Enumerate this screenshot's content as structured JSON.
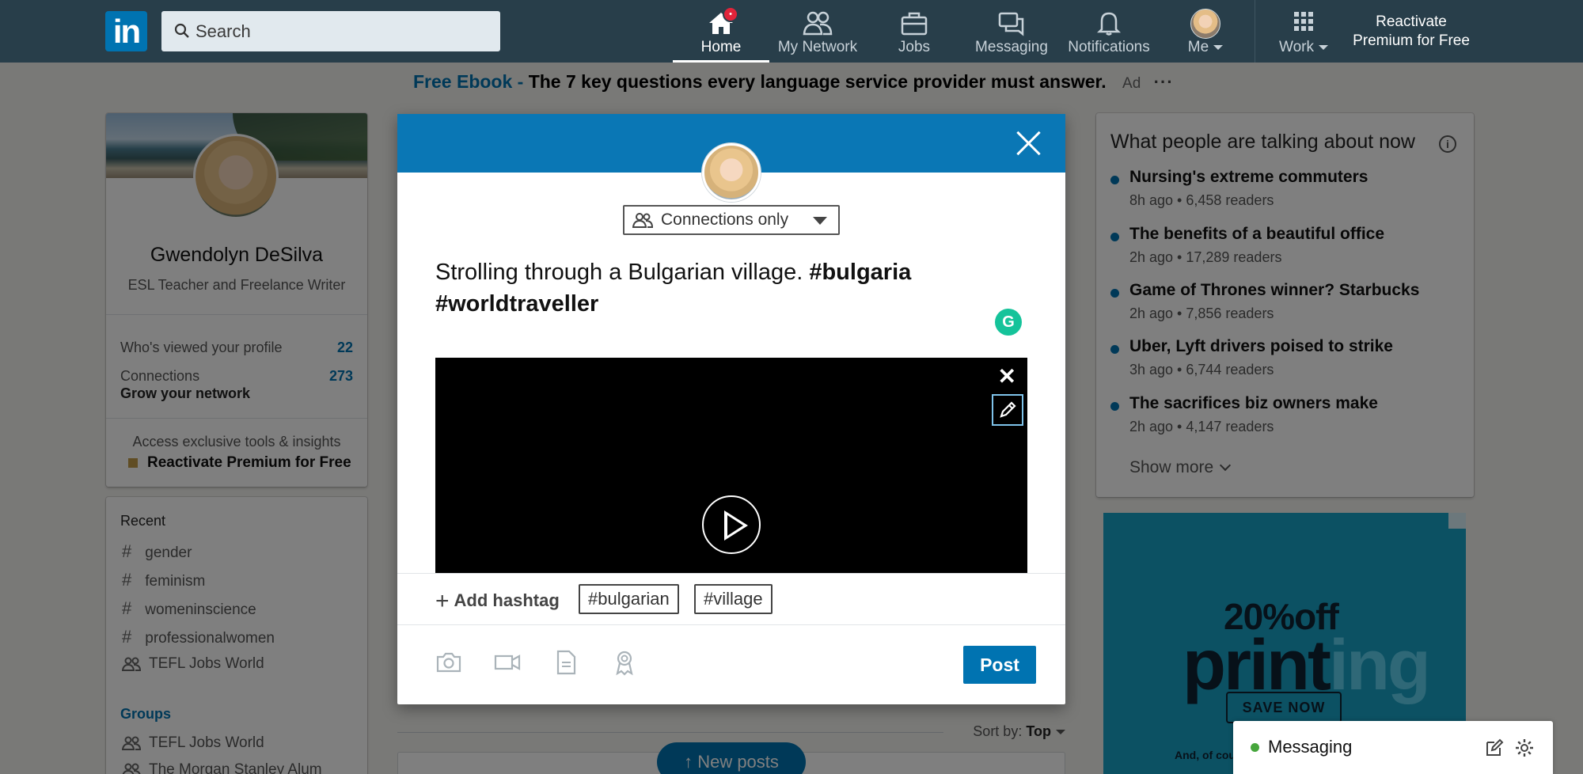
{
  "nav": {
    "logo": "in",
    "search_placeholder": "Search",
    "items": [
      {
        "label": "Home",
        "icon": "home-icon",
        "badge": "•"
      },
      {
        "label": "My Network",
        "icon": "network-icon"
      },
      {
        "label": "Jobs",
        "icon": "briefcase-icon"
      },
      {
        "label": "Messaging",
        "icon": "chat-icon"
      },
      {
        "label": "Notifications",
        "icon": "bell-icon"
      },
      {
        "label": "Me",
        "icon": "avatar"
      },
      {
        "label": "Work",
        "icon": "grid-icon"
      }
    ],
    "premium": "Reactivate Premium for Free"
  },
  "ad": {
    "link": "Free Ebook -",
    "text": "The 7 key questions every language service provider must answer.",
    "tag": "Ad",
    "more": "···"
  },
  "profile": {
    "name": "Gwendolyn DeSilva",
    "headline": "ESL Teacher and Freelance Writer",
    "viewed_label": "Who's viewed your profile",
    "viewed_count": "22",
    "connections_label": "Connections",
    "connections_count": "273",
    "grow": "Grow your network",
    "access": "Access exclusive tools & insights",
    "reactivate": "Reactivate Premium for Free"
  },
  "recent": {
    "title": "Recent",
    "items": [
      {
        "label": "gender",
        "type": "hashtag"
      },
      {
        "label": "feminism",
        "type": "hashtag"
      },
      {
        "label": "womeninscience",
        "type": "hashtag"
      },
      {
        "label": "professionalwomen",
        "type": "hashtag"
      },
      {
        "label": "TEFL Jobs World",
        "type": "group"
      }
    ],
    "groups_title": "Groups",
    "groups": [
      {
        "label": "TEFL Jobs World"
      },
      {
        "label": "The Morgan Stanley Alum"
      }
    ]
  },
  "feed": {
    "sort_label": "Sort by:",
    "sort_value": "Top",
    "new_posts": "↑ New posts"
  },
  "trending": {
    "title": "What people are talking about now",
    "items": [
      {
        "title": "Nursing's extreme commuters",
        "meta": "8h ago • 6,458 readers"
      },
      {
        "title": "The benefits of a beautiful office",
        "meta": "2h ago • 17,289 readers"
      },
      {
        "title": "Game of Thrones winner? Starbucks",
        "meta": "2h ago • 7,856 readers"
      },
      {
        "title": "Uber, Lyft drivers poised to strike",
        "meta": "3h ago • 6,744 readers"
      },
      {
        "title": "The sacrifices biz owners make",
        "meta": "2h ago • 4,147 readers"
      }
    ],
    "show_more": "Show more"
  },
  "side_ad": {
    "headline": "20%off",
    "word_dark": "print",
    "word_light": "ing",
    "cta": "SAVE NOW",
    "fine": "And, of cou"
  },
  "composer": {
    "visibility": "Connections only",
    "text_plain": "Strolling through a Bulgarian village.  ",
    "tag1": "#bulgaria",
    "tag2": "#worldtraveller",
    "add_hashtag": "Add hashtag",
    "suggested": [
      "#bulgarian",
      "#village"
    ],
    "post": "Post"
  },
  "messaging": {
    "label": "Messaging"
  },
  "colors": {
    "nav_bg": "#283e4a",
    "brand_blue": "#0073b1",
    "modal_header": "#0a77b5",
    "online_green": "#46a63c",
    "ad_bg": "#19a3c7"
  }
}
